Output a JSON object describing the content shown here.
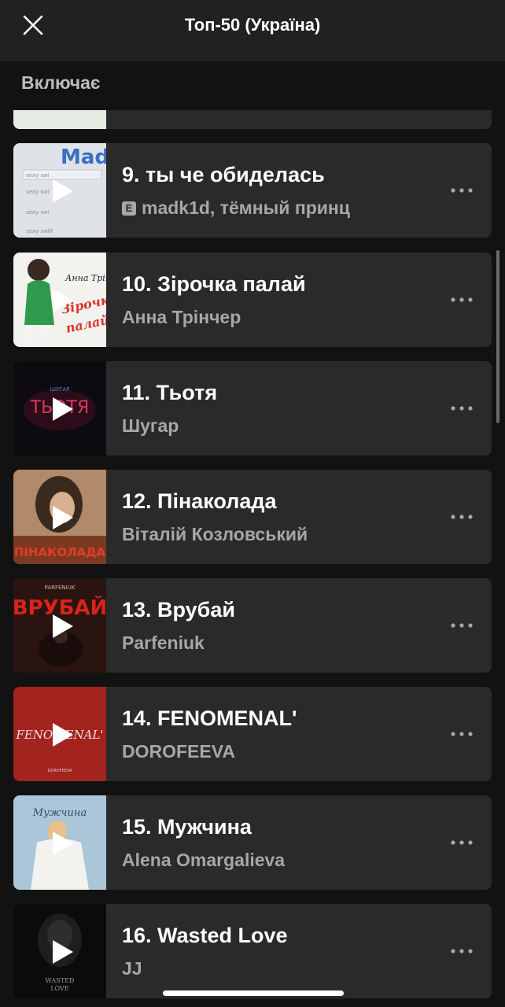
{
  "header": {
    "title": "Топ-50 (Україна)",
    "close_icon": "close-icon"
  },
  "section": {
    "label": "Включає"
  },
  "tracks": [
    {
      "title": "9. ты че обиделась",
      "artist": "madk1d, тёмный принц",
      "explicit": true,
      "explicit_label": "E",
      "cover_text": "Mad",
      "cover_lines": [
        "sexy swi",
        "sexy swi",
        "sexy swi",
        "sexy swift"
      ]
    },
    {
      "title": "10. Зірочка палай",
      "artist": "Анна Трінчер",
      "explicit": false,
      "cover_text": "Анна Трінчер"
    },
    {
      "title": "11. Тьотя",
      "artist": "Шугар",
      "explicit": false,
      "cover_text": "ТЬОТЯ",
      "cover_subtext": "ШУГАР"
    },
    {
      "title": "12. Пінаколада",
      "artist": "Віталій Козловський",
      "explicit": false,
      "cover_text": "ПІНАКОЛАДА"
    },
    {
      "title": "13. Врубай",
      "artist": "Parfeniuk",
      "explicit": false,
      "cover_text": "ВРУБАЙ",
      "cover_subtext": "PARFENIUK"
    },
    {
      "title": "14. FENOMENAL'",
      "artist": "DOROFEEVA",
      "explicit": false,
      "cover_text": "FENOMENAL'",
      "cover_subtext": "DOROFEEVA"
    },
    {
      "title": "15. Мужчина",
      "artist": "Alena Omargalieva",
      "explicit": false,
      "cover_text": "Мужчина"
    },
    {
      "title": "16. Wasted Love",
      "artist": "JJ",
      "explicit": false,
      "cover_text": "WASTED",
      "cover_subtext": "LOVE"
    }
  ],
  "colors": {
    "background": "#121212",
    "card": "#2a2a2a",
    "header": "#212121",
    "secondary_text": "#a7a7a7"
  }
}
